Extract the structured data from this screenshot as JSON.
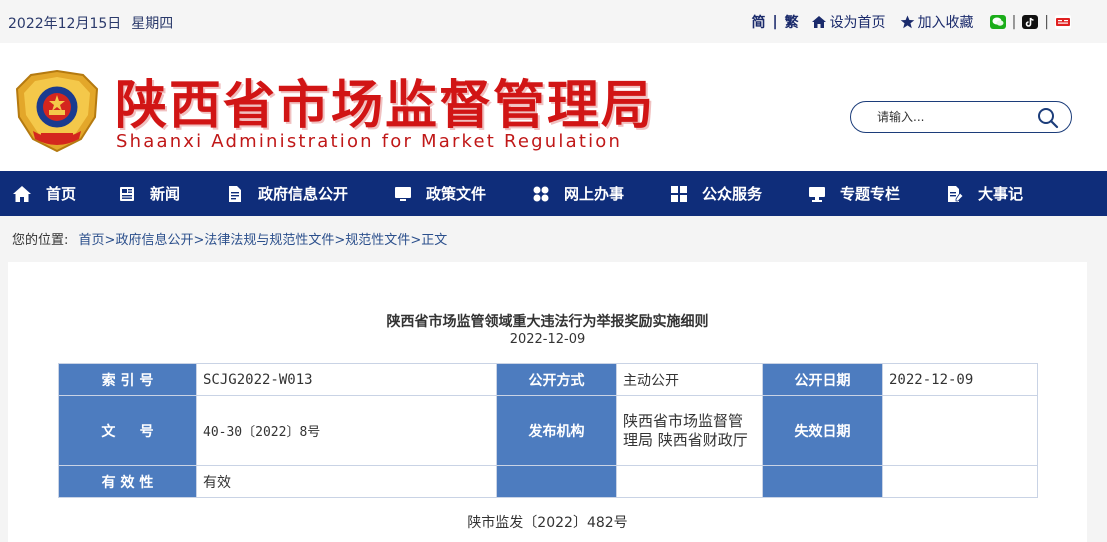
{
  "topbar": {
    "date": "2022年12月15日",
    "weekday": "星期四",
    "lang_simplified": "简",
    "lang_traditional": "繁",
    "set_home": "设为首页",
    "add_favorite": "加入收藏",
    "icons": [
      "wechat-icon",
      "tiktok-icon",
      "weibo-icon"
    ]
  },
  "header": {
    "title_cn": "陕西省市场监督管理局",
    "title_en": "Shaanxi Administration for Market Regulation",
    "search_placeholder": "请输入..."
  },
  "nav": [
    {
      "label": "首页",
      "icon": "home-icon"
    },
    {
      "label": "新闻",
      "icon": "news-icon"
    },
    {
      "label": "政府信息公开",
      "icon": "document-icon"
    },
    {
      "label": "政策文件",
      "icon": "monitor-icon"
    },
    {
      "label": "网上办事",
      "icon": "apps-icon"
    },
    {
      "label": "公众服务",
      "icon": "grid-icon"
    },
    {
      "label": "专题专栏",
      "icon": "screen-icon"
    },
    {
      "label": "大事记",
      "icon": "edit-icon"
    }
  ],
  "breadcrumb": {
    "prefix": "您的位置:",
    "items": [
      "首页",
      "政府信息公开",
      "法律法规与规范性文件",
      "规范性文件",
      "正文"
    ],
    "separator": ">"
  },
  "article": {
    "title": "陕西省市场监管领域重大违法行为举报奖励实施细则",
    "date": "2022-12-09",
    "doc_number": "陕市监发〔2022〕482号"
  },
  "meta": {
    "index_label": "索 引 号",
    "index_value": "SCJG2022-W013",
    "publicity_label": "公开方式",
    "publicity_value": "主动公开",
    "pubdate_label": "公开日期",
    "pubdate_value": "2022-12-09",
    "docno_label": "文     号",
    "docno_value": "40-30〔2022〕8号",
    "issuer_label": "发布机构",
    "issuer_value": "陕西省市场监督管理局 陕西省财政厅",
    "expiry_label": "失效日期",
    "expiry_value": "",
    "validity_label": "有 效 性",
    "validity_value": "有效"
  },
  "colors": {
    "nav_bg": "#0f2d7a",
    "title_red": "#d11515",
    "label_blue": "#4d7cbf"
  }
}
